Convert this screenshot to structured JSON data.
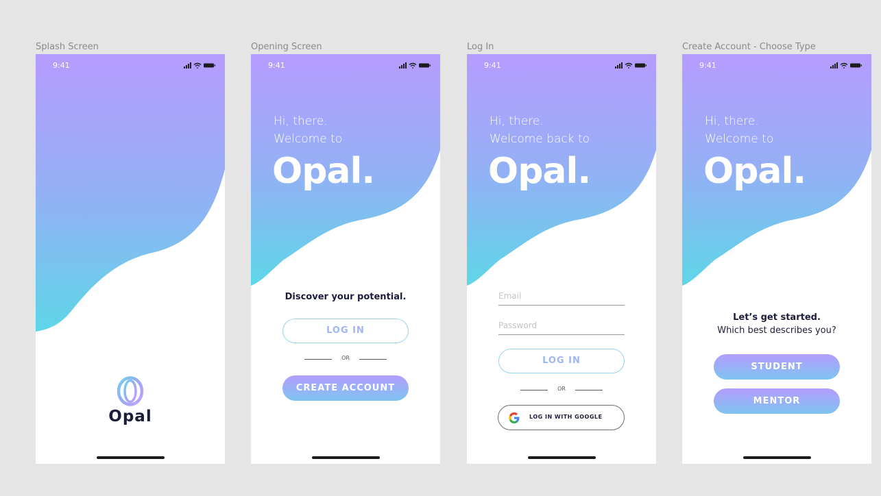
{
  "colors": {
    "gradient_top": "#b49cfe",
    "gradient_bottom": "#5fd6e8",
    "text_dark": "#1c1d3a",
    "outline_text": "#9fb5f5"
  },
  "status_bar": {
    "time": "9:41",
    "icons": [
      "signal-icon",
      "wifi-icon",
      "battery-icon"
    ]
  },
  "screens": [
    {
      "frame_label": "Splash Screen",
      "brand_name": "Opal",
      "logo_icon": "opal-ring-logo"
    },
    {
      "frame_label": "Opening Screen",
      "greeting_line1": "Hi, there.",
      "greeting_line2": "Welcome to",
      "brand": "Opal.",
      "tagline": "Discover your potential.",
      "login_label": "LOG IN",
      "or_label": "OR",
      "create_label": "CREATE ACCOUNT"
    },
    {
      "frame_label": "Log In",
      "greeting_line1": "Hi, there.",
      "greeting_line2": "Welcome back to",
      "brand": "Opal.",
      "email_placeholder": "Email",
      "password_placeholder": "Password",
      "login_label": "LOG IN",
      "or_label": "OR",
      "google_label": "LOG IN WITH GOOGLE"
    },
    {
      "frame_label": "Create Account - Choose Type",
      "greeting_line1": "Hi, there.",
      "greeting_line2": "Welcome to",
      "brand": "Opal.",
      "heading": "Let’s get started.",
      "subheading": "Which best describes you?",
      "student_label": "STUDENT",
      "mentor_label": "MENTOR"
    }
  ]
}
